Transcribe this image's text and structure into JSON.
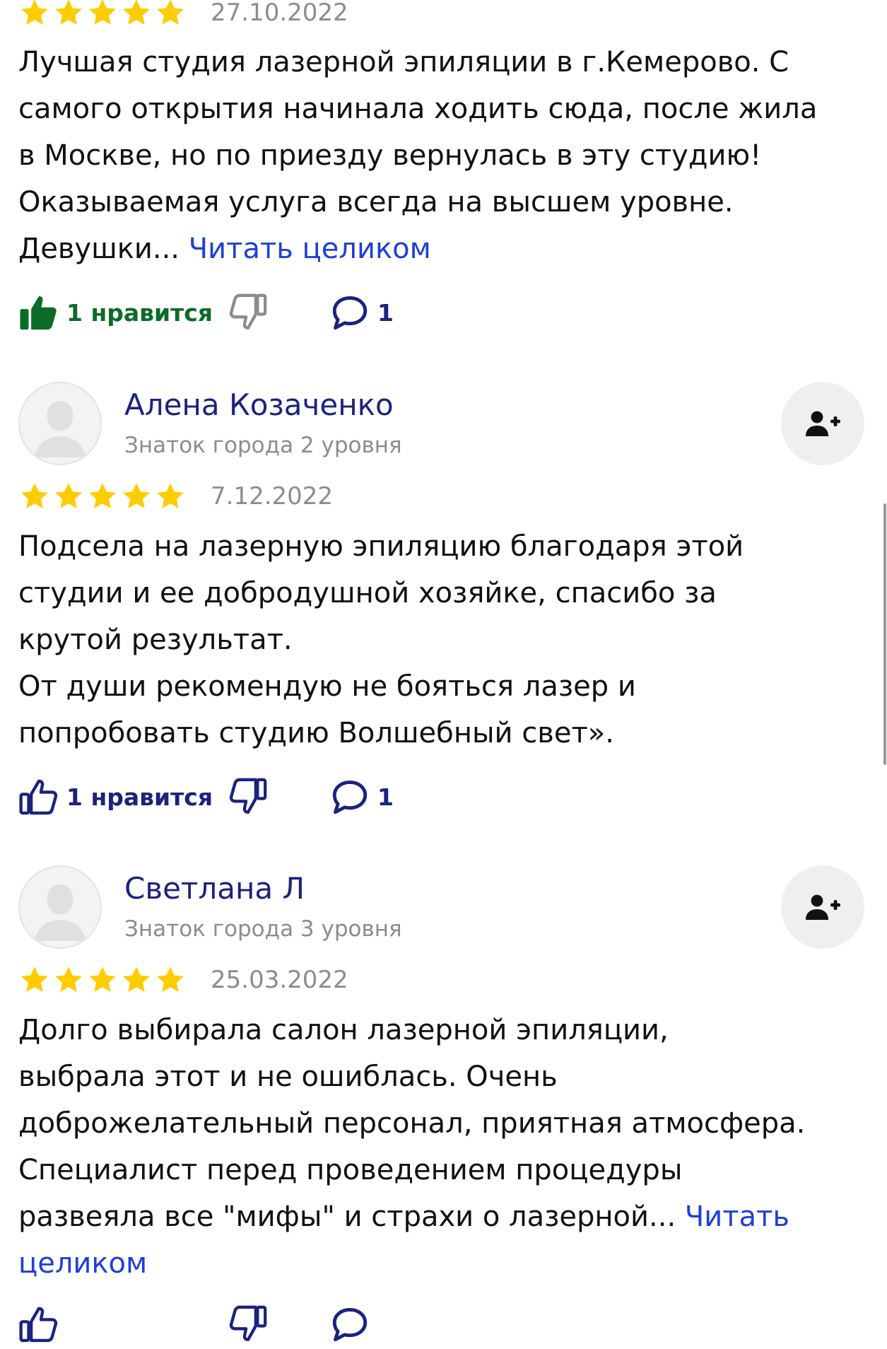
{
  "reviews": [
    {
      "date": "27.10.2022",
      "rating": 5,
      "text_lines": [
        "Лучшая студия лазерной эпиляции в г.Кемерово. С",
        "самого открытия начинала ходить сюда, после жила",
        "в Москве, но по приезду вернулась в эту студию!",
        "Оказываемая услуга всегда на высшем уровне."
      ],
      "last_line": "Девушки...",
      "read_more": "Читать целиком",
      "likes_label": "1 нравится",
      "comments_count": "1",
      "liked": true
    },
    {
      "author": "Алена Козаченко",
      "level": "Знаток города 2 уровня",
      "date": "7.12.2022",
      "rating": 5,
      "text_lines": [
        "Подсела на лазерную эпиляцию благодаря этой",
        "студии и ее добродушной хозяйке, спасибо за",
        "крутой результат.",
        "От души рекомендую не бояться лазер и",
        "попробовать студию Волшебный свет»."
      ],
      "likes_label": "1 нравится",
      "comments_count": "1",
      "liked": false
    },
    {
      "author": "Светлана Л",
      "level": "Знаток города 3 уровня",
      "date": "25.03.2022",
      "rating": 5,
      "text_lines": [
        "Долго выбирала салон лазерной эпиляции,",
        "выбрала этот и не ошиблась. Очень",
        "доброжелательный персонал, приятная атмосфера.",
        "Специалист перед проведением процедуры"
      ],
      "last_line": "развеяла все \"мифы\" и страхи о лазерной...",
      "read_more_1": "Читать",
      "read_more_2": "целиком"
    }
  ],
  "colors": {
    "star": "#FFCC00",
    "author": "#1A237E",
    "link": "#1E3FD6",
    "like_active": "#0C6B26",
    "muted": "#8C8C8C",
    "follow_bg": "#EFEFF2"
  }
}
